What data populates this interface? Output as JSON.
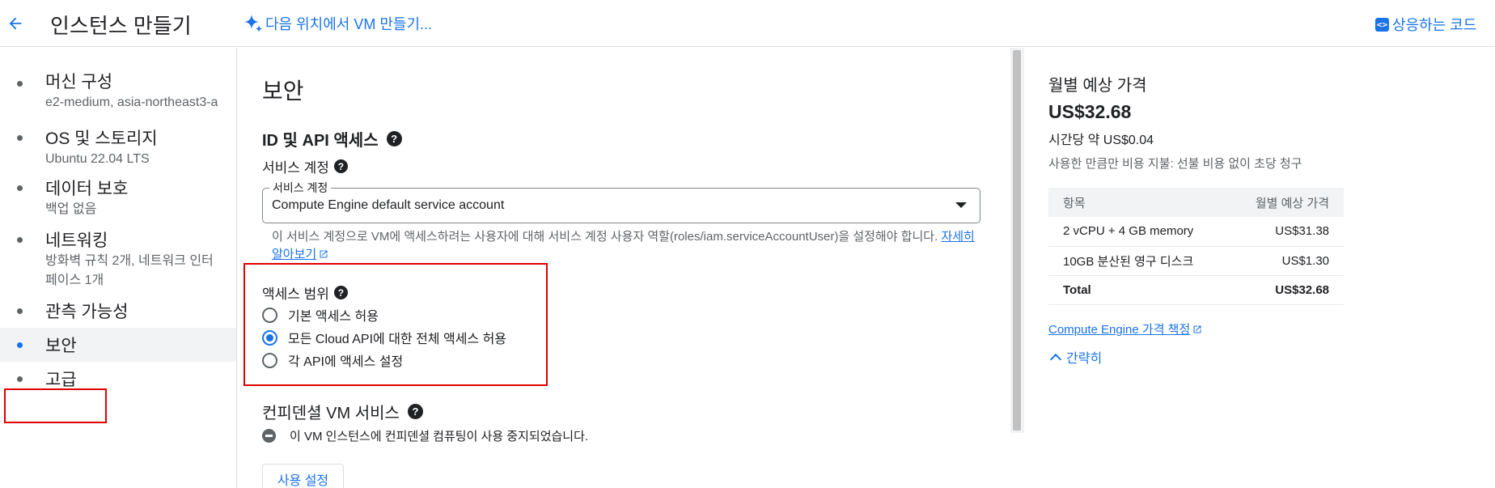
{
  "header": {
    "title": "인스턴스 만들기",
    "gemini_link": "다음 위치에서 VM 만들기...",
    "code_link": "상응하는 코드"
  },
  "sidebar": {
    "items": [
      {
        "label": "머신 구성",
        "sub": "e2-medium, asia-northeast3-a"
      },
      {
        "label": "OS 및 스토리지",
        "sub": "Ubuntu 22.04 LTS"
      },
      {
        "label": "데이터 보호",
        "sub": "백업 없음"
      },
      {
        "label": "네트워킹",
        "sub": "방화벽 규칙 2개, 네트워크 인터페이스 1개"
      },
      {
        "label": "관측 가능성",
        "sub": ""
      },
      {
        "label": "보안",
        "sub": ""
      },
      {
        "label": "고급",
        "sub": ""
      }
    ],
    "active_index": 5
  },
  "main": {
    "section_title": "보안",
    "id_api_title": "ID 및 API 액세스",
    "service_account_label": "서비스 계정",
    "select_legend": "서비스 계정",
    "select_value": "Compute Engine default service account",
    "hint_text": "이 서비스 계정으로 VM에 액세스하려는 사용자에 대해 서비스 계정 사용자 역할(roles/iam.serviceAccountUser)을 설정해야 합니다. ",
    "hint_link": "자세히 알아보기",
    "access_scope_title": "액세스 범위",
    "radios": [
      {
        "label": "기본 액세스 허용",
        "checked": false
      },
      {
        "label": "모든 Cloud API에 대한 전체 액세스 허용",
        "checked": true
      },
      {
        "label": "각 API에 액세스 설정",
        "checked": false
      }
    ],
    "confidential_title": "컨피덴셜 VM 서비스",
    "confidential_status": "이 VM 인스턴스에 컨피덴셜 컴퓨팅이 사용 중지되었습니다.",
    "enable_button": "사용 설정"
  },
  "pricing": {
    "title": "월별 예상 가격",
    "monthly": "US$32.68",
    "hourly": "시간당 약 US$0.04",
    "billing_note": "사용한 만큼만 비용 지불: 선불 비용 없이 초당 청구",
    "table_headers": [
      "항목",
      "월별 예상 가격"
    ],
    "rows": [
      {
        "item": "2 vCPU + 4 GB memory",
        "price": "US$31.38"
      },
      {
        "item": "10GB 분산된 영구 디스크",
        "price": "US$1.30"
      }
    ],
    "total": {
      "item": "Total",
      "price": "US$32.68"
    },
    "pricing_link": "Compute Engine 가격 책정",
    "collapse_label": "간략히"
  },
  "colors": {
    "accent": "#1a73e8",
    "highlight": "#e00000"
  }
}
